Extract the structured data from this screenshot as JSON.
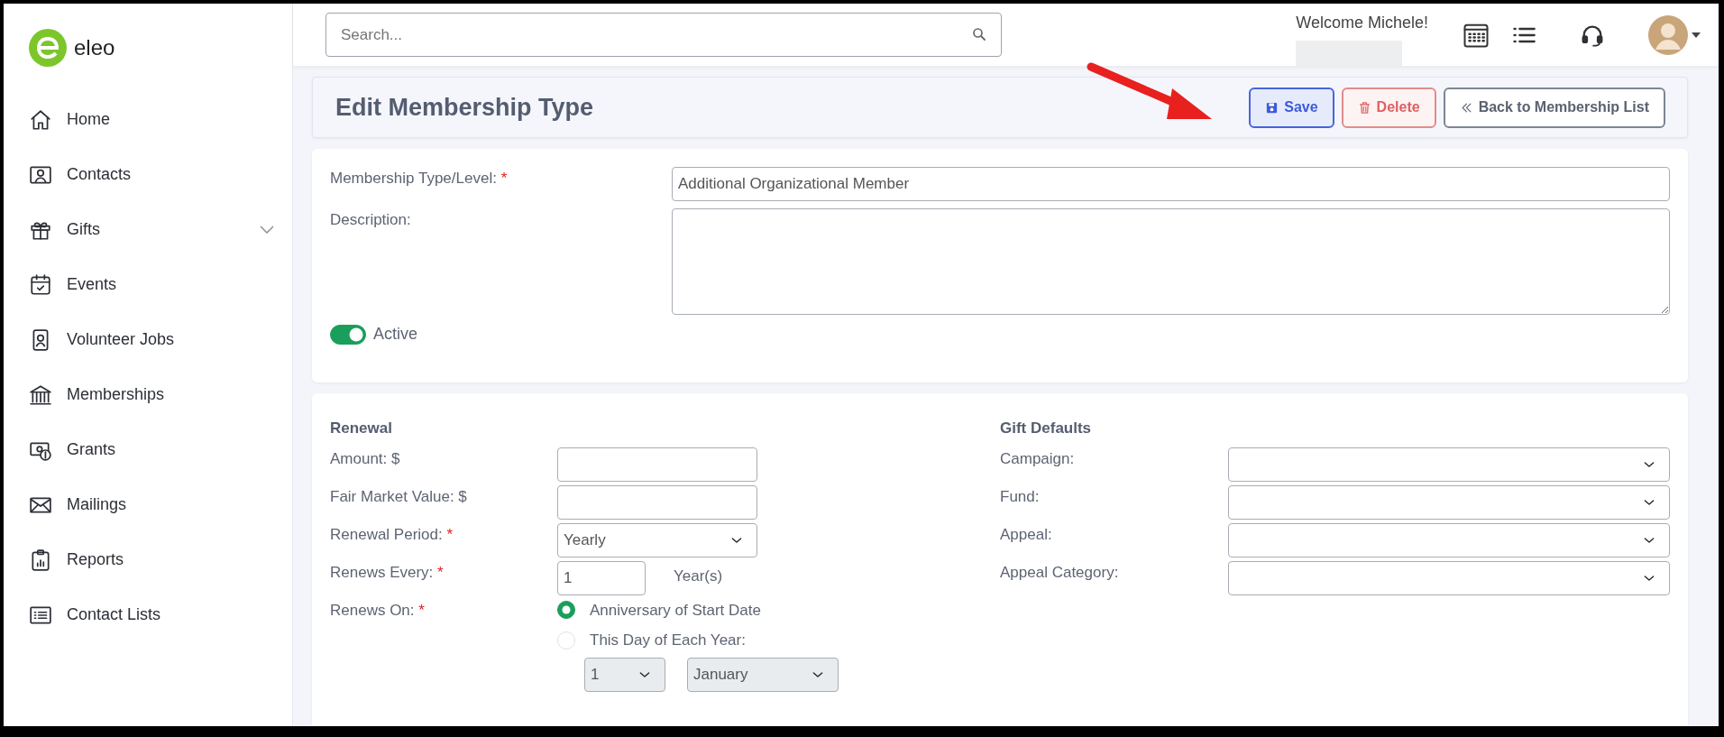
{
  "logo": {
    "text": "eleo"
  },
  "sidebar": {
    "items": [
      {
        "label": "Home",
        "kind": "home",
        "expandable": false,
        "selected": false
      },
      {
        "label": "Contacts",
        "kind": "contacts",
        "expandable": false,
        "selected": false
      },
      {
        "label": "Gifts",
        "kind": "gift",
        "expandable": true,
        "selected": false
      },
      {
        "label": "Events",
        "kind": "events",
        "expandable": false,
        "selected": false
      },
      {
        "label": "Volunteer Jobs",
        "kind": "badge",
        "expandable": false,
        "selected": false
      },
      {
        "label": "Memberships",
        "kind": "bank",
        "expandable": false,
        "selected": false
      },
      {
        "label": "Grants",
        "kind": "money",
        "expandable": false,
        "selected": false
      },
      {
        "label": "Mailings",
        "kind": "mail",
        "expandable": false,
        "selected": false
      },
      {
        "label": "Reports",
        "kind": "report",
        "expandable": false,
        "selected": false
      },
      {
        "label": "Contact Lists",
        "kind": "list",
        "expandable": false,
        "selected": false
      }
    ]
  },
  "header": {
    "search": {
      "placeholder": "Search..."
    },
    "welcome": "Welcome Michele!"
  },
  "page_header": {
    "title": "Edit Membership Type",
    "buttons": [
      {
        "label": "Save",
        "kind": "save"
      },
      {
        "label": "Delete",
        "kind": "delete"
      },
      {
        "label": "Back to Membership List",
        "kind": "back"
      }
    ]
  },
  "general": {
    "membership_type": {
      "label": "Membership Type/Level:",
      "required_mark": "*",
      "value": "Additional Organizational Member"
    },
    "description": {
      "label": "Description:"
    },
    "active": {
      "label": "Active",
      "on": true
    }
  },
  "renewal": {
    "title": "Renewal",
    "fields": [
      {
        "label": "Amount: $",
        "kind": "text"
      },
      {
        "label": "Fair Market Value: $",
        "kind": "text"
      },
      {
        "label": "Renewal Period:",
        "required_mark": "*",
        "kind": "select",
        "value": "Yearly"
      },
      {
        "label": "Renews Every:",
        "required_mark": "*",
        "kind": "number",
        "value": "1",
        "suffix": "Year(s)"
      },
      {
        "label": "Renews On:",
        "required_mark": "*",
        "kind": "radio",
        "options": [
          {
            "label": "Anniversary of Start Date",
            "selected": true
          },
          {
            "label": "This Day of Each Year:",
            "selected": false
          }
        ],
        "day": {
          "value": "1",
          "disabled": true
        },
        "month": {
          "value": "January",
          "disabled": true
        }
      }
    ]
  },
  "gift_defaults": {
    "title": "Gift Defaults",
    "fields": [
      {
        "label": "Campaign:"
      },
      {
        "label": "Fund:"
      },
      {
        "label": "Appeal:"
      },
      {
        "label": "Appeal Category:"
      }
    ]
  }
}
